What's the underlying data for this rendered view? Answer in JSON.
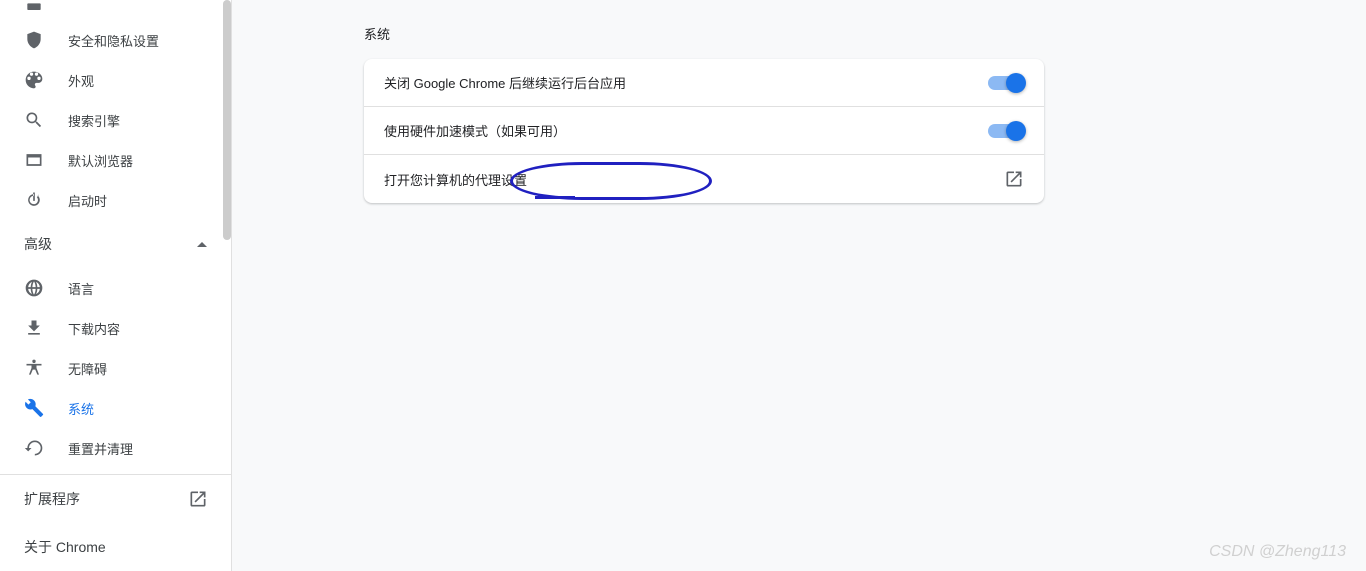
{
  "sidebar": {
    "items": [
      {
        "label": "安全和隐私设置",
        "icon": "shield"
      },
      {
        "label": "外观",
        "icon": "palette"
      },
      {
        "label": "搜索引擎",
        "icon": "search"
      },
      {
        "label": "默认浏览器",
        "icon": "browser"
      },
      {
        "label": "启动时",
        "icon": "power"
      }
    ],
    "advanced_label": "高级",
    "advanced_items": [
      {
        "label": "语言",
        "icon": "globe"
      },
      {
        "label": "下载内容",
        "icon": "download"
      },
      {
        "label": "无障碍",
        "icon": "accessibility"
      },
      {
        "label": "系统",
        "icon": "wrench",
        "active": true
      },
      {
        "label": "重置并清理",
        "icon": "restore"
      }
    ]
  },
  "bottom": {
    "extensions_label": "扩展程序",
    "about_label": "关于 Chrome"
  },
  "main": {
    "section_title": "系统",
    "rows": [
      {
        "label": "关闭 Google Chrome 后继续运行后台应用",
        "type": "toggle",
        "on": true
      },
      {
        "label": "使用硬件加速模式（如果可用）",
        "type": "toggle",
        "on": true
      },
      {
        "label": "打开您计算机的代理设置",
        "type": "external"
      }
    ]
  },
  "watermark": "CSDN @Zheng113"
}
